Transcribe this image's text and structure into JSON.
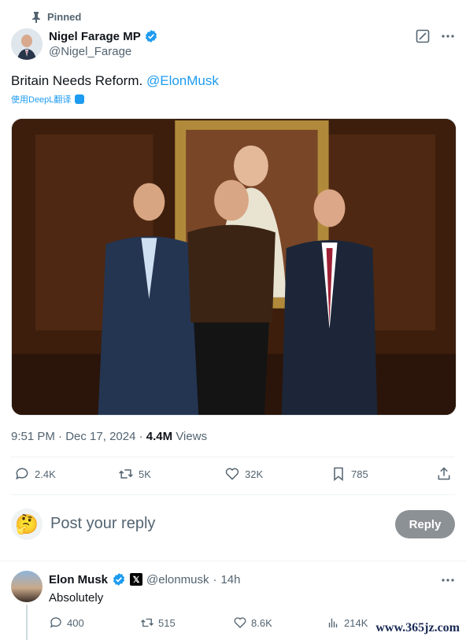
{
  "colors": {
    "accent": "#1d9bf0",
    "muted": "#536471",
    "text": "#0f1419",
    "reply_button_bg": "#8c9196"
  },
  "pinned_label": "Pinned",
  "author": {
    "name": "Nigel Farage MP",
    "handle": "@Nigel_Farage",
    "verified": true
  },
  "top_actions": [
    {
      "icon": "grok-icon"
    },
    {
      "icon": "more-icon"
    }
  ],
  "tweet": {
    "text": "Britain Needs Reform.",
    "mention": "@ElonMusk",
    "translate_label": "使用DeepL翻译",
    "image_alt_icon": "photo"
  },
  "meta": {
    "time": "9:51 PM",
    "date": "Dec 17, 2024",
    "separator": "·",
    "views_count": "4.4M",
    "views_label": "Views"
  },
  "stats": {
    "replies": "2.4K",
    "reposts": "5K",
    "likes": "32K",
    "bookmarks": "785"
  },
  "reply_composer": {
    "avatar_emoji": "🤔",
    "placeholder": "Post your reply",
    "button_label": "Reply"
  },
  "reply": {
    "name": "Elon Musk",
    "verified": true,
    "affiliate_badge": "𝕏",
    "handle": "@elonmusk",
    "separator": "·",
    "time": "14h",
    "text": "Absolutely",
    "stats": {
      "replies": "400",
      "reposts": "515",
      "likes": "8.6K",
      "views": "214K"
    }
  },
  "watermark": "www.365jz.com"
}
